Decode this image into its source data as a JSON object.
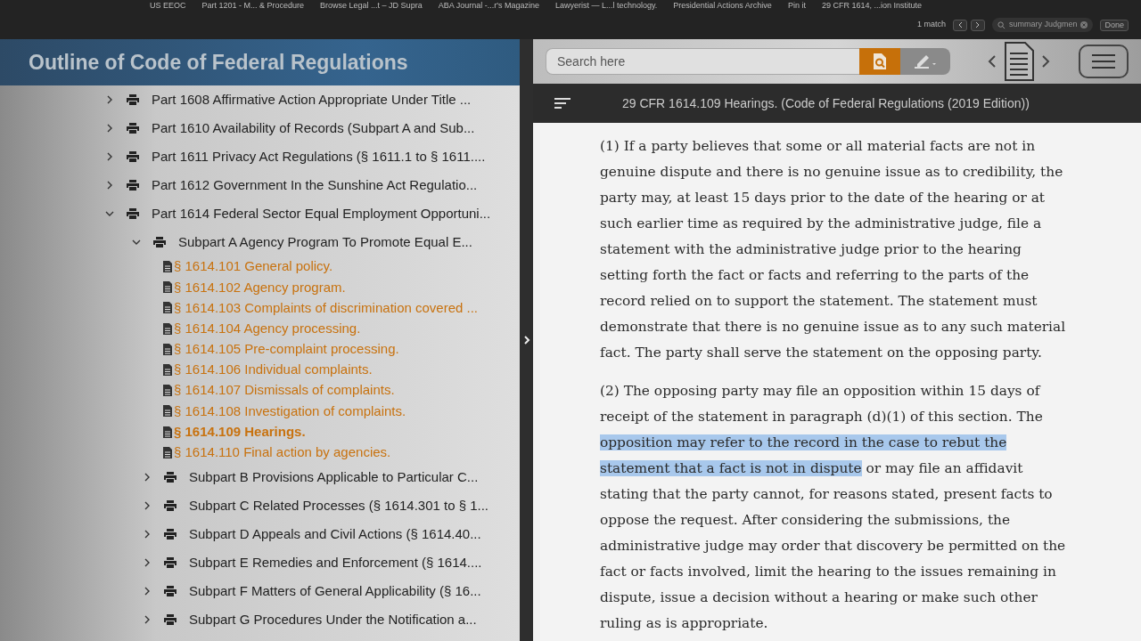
{
  "bookmarks": [
    "US EEOC",
    "Part 1201 - M... & Procedure",
    "Browse Legal ...t – JD Supra",
    "ABA Journal -...r's Magazine",
    "Lawyerist — L...l technology.",
    "Presidential Actions Archive",
    "Pin it",
    "29 CFR 1614, ...ion Institute"
  ],
  "find_bar": {
    "matches": "1 match",
    "query": "summary Judgmen",
    "done": "Done"
  },
  "sidebar": {
    "title": "Outline of Code of Federal Regulations",
    "items": [
      {
        "kind": "part",
        "label": "Part 1608 Affirmative Action Appropriate Under Title ...",
        "expanded": false
      },
      {
        "kind": "part",
        "label": "Part 1610 Availability of Records (Subpart A and Sub...",
        "expanded": false
      },
      {
        "kind": "part",
        "label": "Part 1611 Privacy Act Regulations (§ 1611.1 to § 1611....",
        "expanded": false
      },
      {
        "kind": "part",
        "label": "Part 1612 Government In the Sunshine Act Regulatio...",
        "expanded": false
      },
      {
        "kind": "part",
        "label": "Part 1614 Federal Sector Equal Employment Opportuni...",
        "expanded": true,
        "children": [
          {
            "kind": "part",
            "label": "Subpart A Agency Program To Promote Equal E...",
            "expanded": true,
            "children": [
              {
                "kind": "section",
                "label": "§ 1614.101 General policy.",
                "selected": false
              },
              {
                "kind": "section",
                "label": "§ 1614.102 Agency program.",
                "selected": false
              },
              {
                "kind": "section",
                "label": "§ 1614.103 Complaints of discrimination covered ...",
                "selected": false
              },
              {
                "kind": "section",
                "label": "§ 1614.104 Agency processing.",
                "selected": false
              },
              {
                "kind": "section",
                "label": "§ 1614.105 Pre-complaint processing.",
                "selected": false
              },
              {
                "kind": "section",
                "label": "§ 1614.106 Individual complaints.",
                "selected": false
              },
              {
                "kind": "section",
                "label": "§ 1614.107 Dismissals of complaints.",
                "selected": false
              },
              {
                "kind": "section",
                "label": "§ 1614.108 Investigation of complaints.",
                "selected": false
              },
              {
                "kind": "section",
                "label": "§ 1614.109 Hearings.",
                "selected": true
              },
              {
                "kind": "section",
                "label": "§ 1614.110 Final action by agencies.",
                "selected": false
              }
            ]
          },
          {
            "kind": "part",
            "label": "Subpart B Provisions Applicable to Particular C...",
            "expanded": false
          },
          {
            "kind": "part",
            "label": "Subpart C Related Processes (§ 1614.301 to § 1...",
            "expanded": false
          },
          {
            "kind": "part",
            "label": "Subpart D Appeals and Civil Actions (§ 1614.40...",
            "expanded": false
          },
          {
            "kind": "part",
            "label": "Subpart E Remedies and Enforcement (§ 1614....",
            "expanded": false
          },
          {
            "kind": "part",
            "label": "Subpart F Matters of General Applicability (§ 16...",
            "expanded": false
          },
          {
            "kind": "part",
            "label": "Subpart G Procedures Under the Notification a...",
            "expanded": false
          }
        ]
      }
    ]
  },
  "search": {
    "placeholder": "Search here"
  },
  "document": {
    "title": "29 CFR 1614.109 Hearings. (Code of Federal Regulations (2019 Edition))",
    "paragraphs": [
      [
        {
          "text": "(1) If a party believes that some or all material facts are not in genuine dispute and there is no genuine issue as to credibility, the party may, at least 15 days prior to the date of the hearing or at such earlier time as required by the administrative judge, file a statement with the administrative judge prior to the hearing setting forth the fact or facts and referring to the parts of the record relied on to support the statement. The statement must demonstrate that there is no genuine issue as to any such material fact. The party shall serve the statement on the opposing party.",
          "highlighted": false
        }
      ],
      [
        {
          "text": "(2) The opposing party may file an opposition within 15 days of receipt of the statement in paragraph (d)(1) of this section. The ",
          "highlighted": false
        },
        {
          "text": "opposition may refer to the record in the case to rebut the statement that a fact is not in dispute",
          "highlighted": true
        },
        {
          "text": " or may file an affidavit stating that the party cannot, for reasons stated, present facts to oppose the request. After considering the submissions, the administrative judge may order that discovery be permitted on the fact or facts involved, limit the hearing to the issues remaining in dispute, issue a decision without a hearing or make such other ruling as is appropriate.",
          "highlighted": false
        }
      ]
    ]
  }
}
